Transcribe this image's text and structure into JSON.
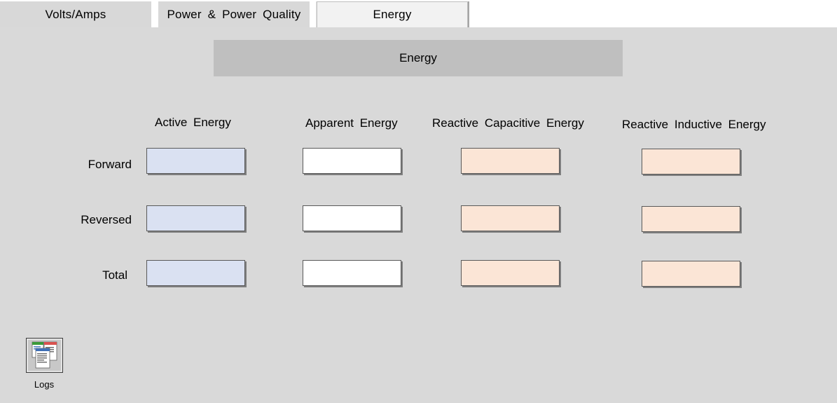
{
  "tabs": [
    {
      "label": "Volts/Amps",
      "active": false
    },
    {
      "label": "Power & Power Quality",
      "active": false
    },
    {
      "label": "Energy",
      "active": true
    }
  ],
  "section": {
    "title": "Energy"
  },
  "columns": [
    "Active Energy",
    "Apparent Energy",
    "Reactive Capacitive Energy",
    "Reactive Inductive Energy"
  ],
  "rows": [
    "Forward",
    "Reversed",
    "Total"
  ],
  "values": [
    [
      "",
      "",
      "",
      ""
    ],
    [
      "",
      "",
      "",
      ""
    ],
    [
      "",
      "",
      "",
      ""
    ]
  ],
  "colors": {
    "active": "#dae1f2",
    "apparent": "#ffffff",
    "reactive": "#fbe5d6",
    "panel": "#d9d9d9",
    "header": "#bfbfbf"
  },
  "logs": {
    "label": "Logs",
    "icon": "logs-icon"
  }
}
